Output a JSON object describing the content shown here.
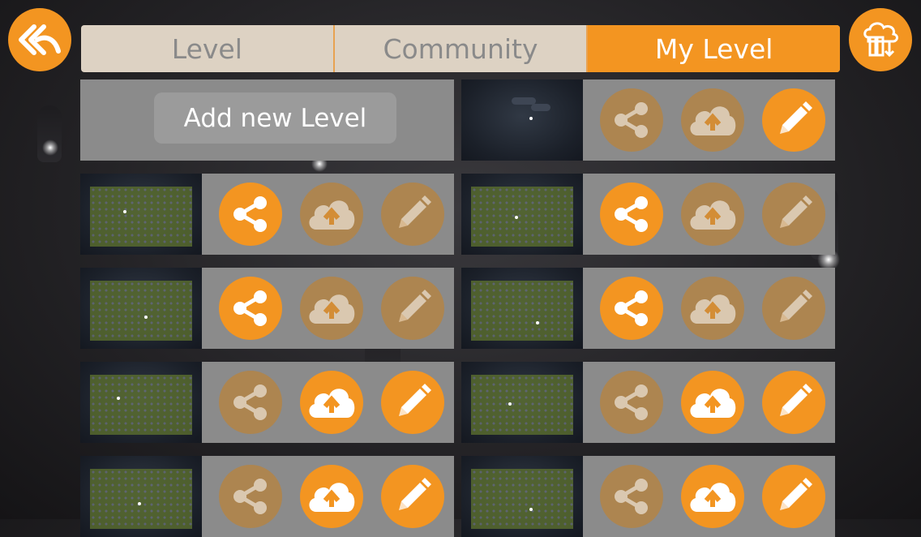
{
  "tabs": [
    {
      "label": "Level",
      "active": false
    },
    {
      "label": "Community",
      "active": false
    },
    {
      "label": "My Level",
      "active": true
    }
  ],
  "add_new_label": "Add new Level",
  "icons": {
    "back": "double-chevron-back-icon",
    "library": "library-cloud-icon",
    "share": "share-icon",
    "upload": "cloud-upload-icon",
    "edit": "pencil-icon"
  },
  "colors": {
    "accent": "#f39521",
    "accent_dim": "#ad8550",
    "row_bg": "#8b8b8b",
    "tab_bg": "#ddd2c3"
  },
  "levels": [
    {
      "share_enabled": false,
      "upload_enabled": false,
      "edit_enabled": true
    },
    {
      "share_enabled": true,
      "upload_enabled": false,
      "edit_enabled": false
    },
    {
      "share_enabled": true,
      "upload_enabled": false,
      "edit_enabled": false
    },
    {
      "share_enabled": true,
      "upload_enabled": false,
      "edit_enabled": false
    },
    {
      "share_enabled": true,
      "upload_enabled": false,
      "edit_enabled": false
    },
    {
      "share_enabled": false,
      "upload_enabled": true,
      "edit_enabled": true
    },
    {
      "share_enabled": false,
      "upload_enabled": true,
      "edit_enabled": true
    },
    {
      "share_enabled": false,
      "upload_enabled": true,
      "edit_enabled": true
    },
    {
      "share_enabled": false,
      "upload_enabled": true,
      "edit_enabled": true
    }
  ]
}
